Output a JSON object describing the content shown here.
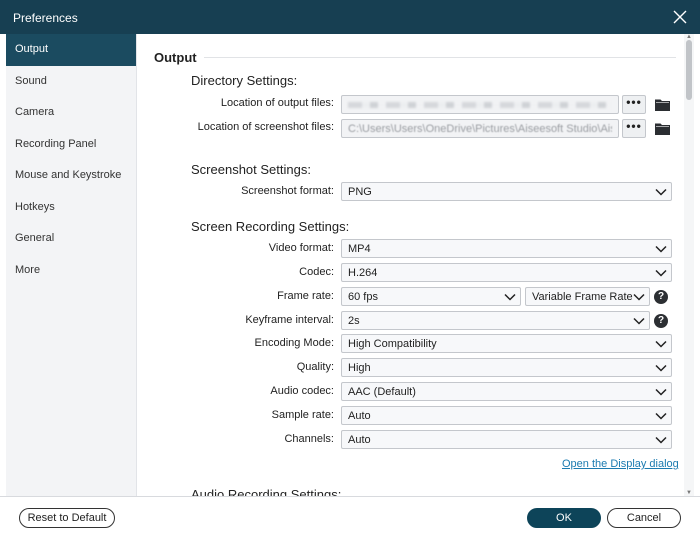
{
  "window": {
    "title": "Preferences"
  },
  "sidebar": {
    "items": [
      {
        "label": "Output",
        "active": true
      },
      {
        "label": "Sound"
      },
      {
        "label": "Camera"
      },
      {
        "label": "Recording Panel"
      },
      {
        "label": "Mouse and Keystroke"
      },
      {
        "label": "Hotkeys"
      },
      {
        "label": "General"
      },
      {
        "label": "More"
      }
    ]
  },
  "output": {
    "title": "Output",
    "directory": {
      "title": "Directory Settings:",
      "output_files_label": "Location of output files:",
      "screenshot_files_label": "Location of screenshot files:",
      "screenshot_path": "C:\\Users\\Users\\OneDrive\\Pictures\\Aiseesoft Studio\\Aise",
      "browse_label": "•••"
    },
    "screenshot": {
      "title": "Screenshot Settings:",
      "format_label": "Screenshot format:",
      "format_value": "PNG"
    },
    "recording": {
      "title": "Screen Recording Settings:",
      "video_format_label": "Video format:",
      "video_format_value": "MP4",
      "codec_label": "Codec:",
      "codec_value": "H.264",
      "frame_rate_label": "Frame rate:",
      "frame_rate_value": "60 fps",
      "frame_rate_mode_value": "Variable Frame Rate",
      "keyframe_label": "Keyframe interval:",
      "keyframe_value": "2s",
      "encoding_label": "Encoding Mode:",
      "encoding_value": "High Compatibility",
      "quality_label": "Quality:",
      "quality_value": "High",
      "audio_codec_label": "Audio codec:",
      "audio_codec_value": "AAC (Default)",
      "sample_rate_label": "Sample rate:",
      "sample_rate_value": "Auto",
      "channels_label": "Channels:",
      "channels_value": "Auto",
      "display_link": "Open the Display dialog"
    },
    "audio_recording": {
      "title": "Audio Recording Settings:"
    }
  },
  "footer": {
    "reset_label": "Reset to Default",
    "ok_label": "OK",
    "cancel_label": "Cancel"
  },
  "colors": {
    "titlebar": "#173f52",
    "accent": "#1b4b60",
    "link": "#1c7bb0"
  }
}
